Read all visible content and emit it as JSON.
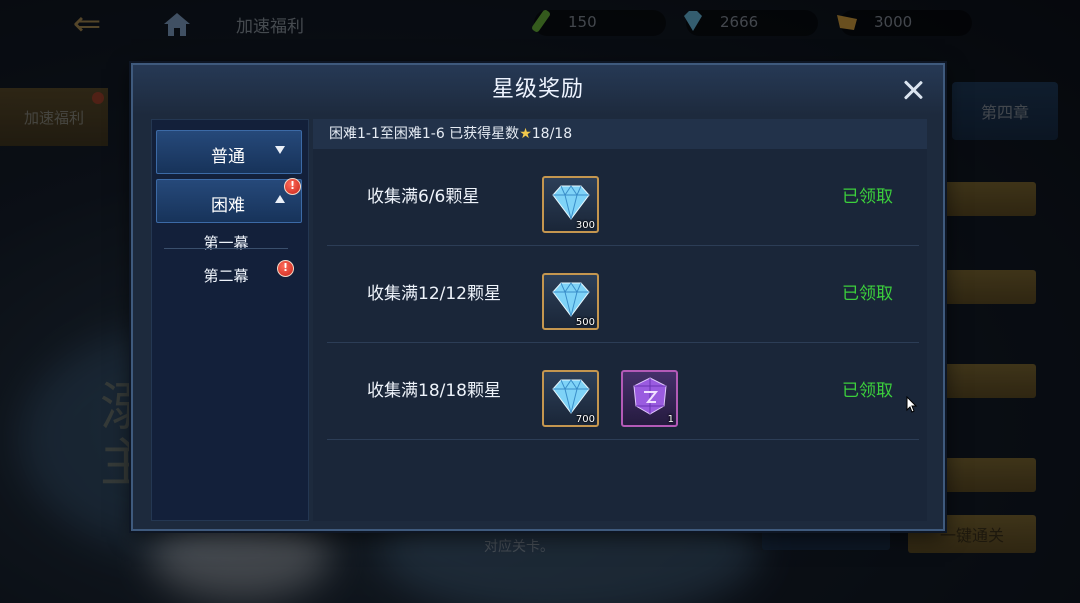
{
  "topbar": {
    "breadcrumb_title": "加速福利",
    "currencies": [
      {
        "icon": "stamina-icon",
        "value": "150"
      },
      {
        "icon": "diamond-icon",
        "value": "2666"
      },
      {
        "icon": "gold-icon",
        "value": "3000"
      }
    ]
  },
  "background": {
    "side_tab_label": "加速福利",
    "right_header_label": "第四章",
    "bottom_button_label": "一键通关",
    "bottom_text": "对应关卡。"
  },
  "dialog": {
    "title": "星级奖励",
    "sidebar": {
      "tabs": [
        {
          "label": "普通",
          "expanded": false
        },
        {
          "label": "困难",
          "expanded": true,
          "badge": "!"
        }
      ],
      "sub_items": [
        {
          "label": "第一幕"
        },
        {
          "label": "第二幕",
          "badge": "!"
        }
      ]
    },
    "summary": {
      "prefix": "困难1-1至困难1-6 已获得星数",
      "star": "★",
      "value": "18/18"
    },
    "rewards": [
      {
        "label": "收集满6/6颗星",
        "items": [
          {
            "icon": "diamond-icon",
            "qty": "300",
            "rarity": "gold"
          }
        ],
        "status": "已领取"
      },
      {
        "label": "收集满12/12颗星",
        "items": [
          {
            "icon": "diamond-icon",
            "qty": "500",
            "rarity": "gold"
          }
        ],
        "status": "已领取"
      },
      {
        "label": "收集满18/18颗星",
        "items": [
          {
            "icon": "diamond-icon",
            "qty": "700",
            "rarity": "gold"
          },
          {
            "icon": "purple-crystal-icon",
            "qty": "1",
            "rarity": "purple"
          }
        ],
        "status": "已领取"
      }
    ]
  },
  "colors": {
    "claimed_green": "#3ccf3c",
    "dialog_bg": "#1d2a3d",
    "star_gold": "#f2c94c"
  }
}
